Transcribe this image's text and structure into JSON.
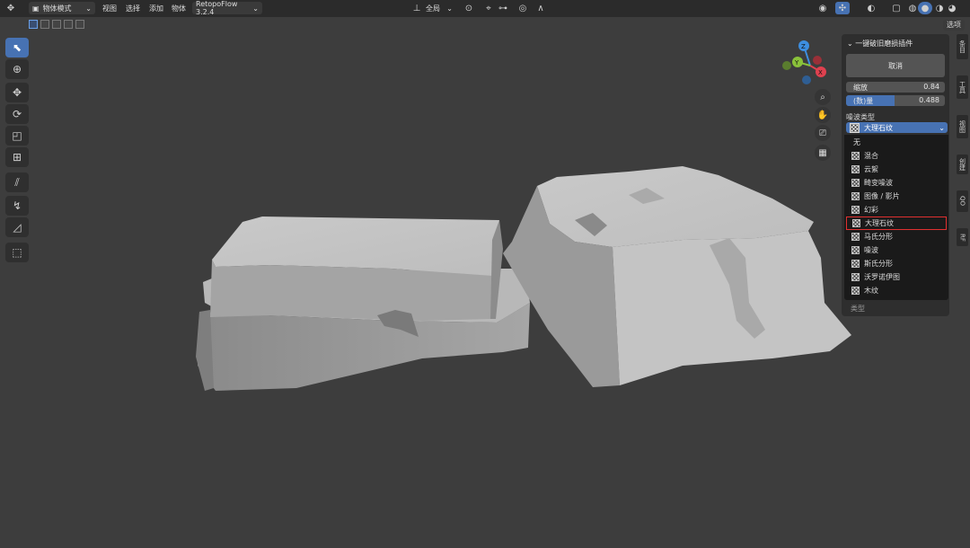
{
  "header": {
    "mode_label": "物体模式",
    "menus": [
      "视图",
      "选择",
      "添加",
      "物体"
    ],
    "addon_label": "RetopoFlow 3.2.4",
    "transform_label": "全局",
    "options_label": "选项"
  },
  "panel": {
    "title": "一键破旧磨损插件",
    "cancel_label": "取消",
    "sliders": [
      {
        "label": "缩放",
        "value": "0.84",
        "fill": 0.0
      },
      {
        "label": "(数)量",
        "value": "0.488",
        "fill": 0.488
      }
    ],
    "noise_type_label": "噪波类型",
    "selected_value": "大理石纹",
    "footer_label": "类型"
  },
  "dropdown": {
    "options": [
      {
        "label": "无",
        "icon": false
      },
      {
        "label": "混合",
        "icon": true
      },
      {
        "label": "云絮",
        "icon": true
      },
      {
        "label": "畸变噪波",
        "icon": true
      },
      {
        "label": "图像 / 影片",
        "icon": true
      },
      {
        "label": "幻彩",
        "icon": true
      },
      {
        "label": "大理石纹",
        "icon": true,
        "highlighted": true
      },
      {
        "label": "马氏分形",
        "icon": true
      },
      {
        "label": "噪波",
        "icon": true
      },
      {
        "label": "斯氏分形",
        "icon": true
      },
      {
        "label": "沃罗诺伊图",
        "icon": true
      },
      {
        "label": "木纹",
        "icon": true
      }
    ]
  },
  "gizmo": {
    "z": "Z",
    "y": "Y",
    "x": "X"
  },
  "side_tabs": [
    "条目",
    "工具",
    "视图",
    "创建",
    "QO",
    "RF"
  ],
  "colors": {
    "accent": "#4772b3",
    "highlight_border": "#e03030",
    "x_axis": "#e0414f",
    "y_axis": "#8ac23a",
    "z_axis": "#3d8ee0"
  }
}
